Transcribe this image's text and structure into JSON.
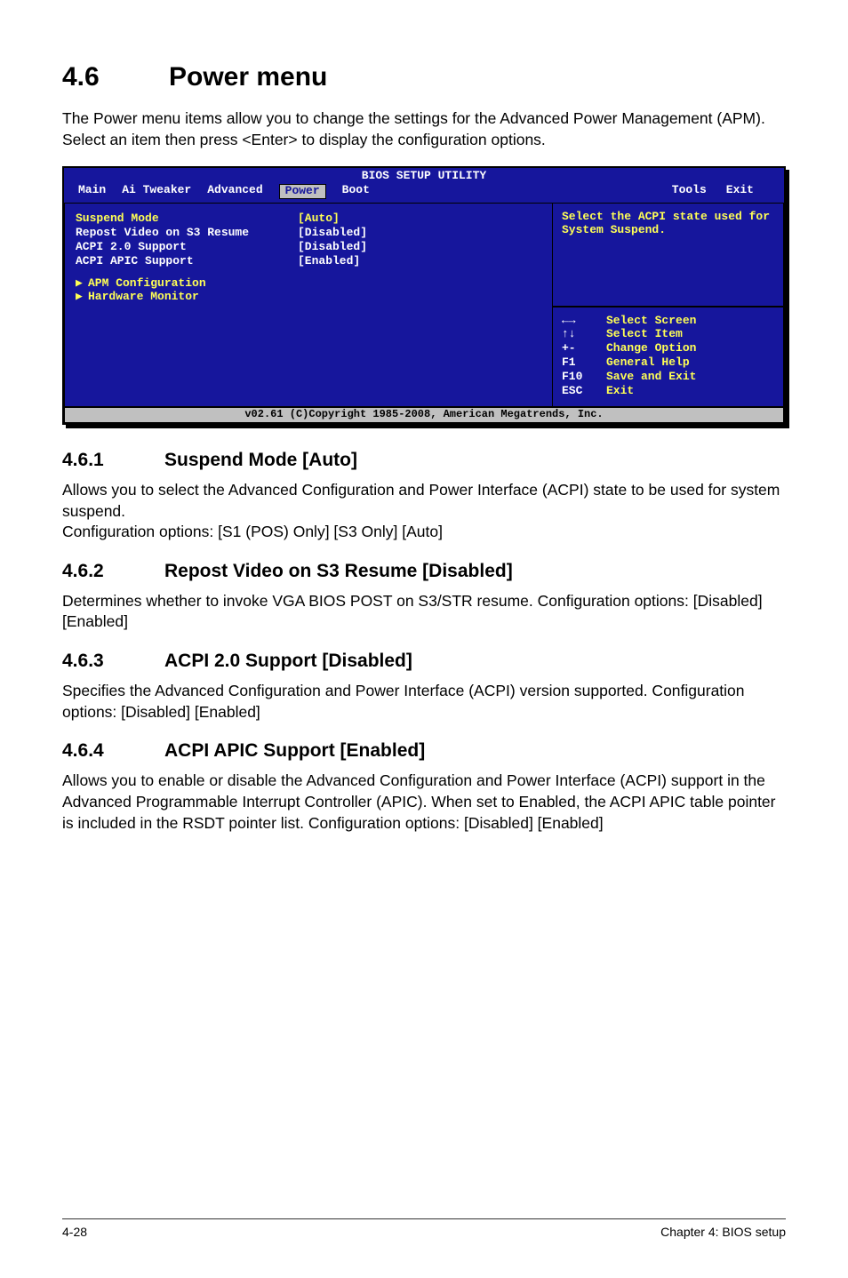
{
  "heading": {
    "num": "4.6",
    "title": "Power menu"
  },
  "intro": "The Power menu items allow you to change the settings for the Advanced Power Management (APM). Select an item then press <Enter> to display the configuration options.",
  "bios": {
    "title": "BIOS SETUP UTILITY",
    "menus": [
      "Main",
      "Ai Tweaker",
      "Advanced",
      "Power",
      "Boot",
      "Tools",
      "Exit"
    ],
    "selected_menu": "Power",
    "options": [
      {
        "label": "Suspend Mode",
        "value": "[Auto]",
        "enabled": true
      },
      {
        "label": "Repost Video on S3 Resume",
        "value": "[Disabled]",
        "enabled": false
      },
      {
        "label": "ACPI 2.0 Support",
        "value": "[Disabled]",
        "enabled": false
      },
      {
        "label": "ACPI APIC Support",
        "value": "[Enabled]",
        "enabled": false
      }
    ],
    "submenus": [
      "APM Configuration",
      "Hardware Monitor"
    ],
    "help": "Select the ACPI state used for System Suspend.",
    "keys": [
      {
        "k": "←→",
        "d": "Select Screen"
      },
      {
        "k": "↑↓",
        "d": "Select Item"
      },
      {
        "k": "+-",
        "d": "Change Option"
      },
      {
        "k": "F1",
        "d": "General Help"
      },
      {
        "k": "F10",
        "d": "Save and Exit"
      },
      {
        "k": "ESC",
        "d": "Exit"
      }
    ],
    "footer": "v02.61 (C)Copyright 1985-2008, American Megatrends, Inc."
  },
  "sections": [
    {
      "num": "4.6.1",
      "title": "Suspend Mode [Auto]",
      "body": "Allows you to select the Advanced Configuration and Power Interface (ACPI) state to be used for system suspend.\nConfiguration options: [S1 (POS) Only] [S3 Only] [Auto]"
    },
    {
      "num": "4.6.2",
      "title": "Repost Video on S3 Resume [Disabled]",
      "body": "Determines whether to invoke VGA BIOS POST on S3/STR resume. Configuration options: [Disabled] [Enabled]"
    },
    {
      "num": "4.6.3",
      "title": "ACPI 2.0 Support [Disabled]",
      "body": "Specifies the Advanced Configuration and Power Interface (ACPI) version supported. Configuration options: [Disabled] [Enabled]"
    },
    {
      "num": "4.6.4",
      "title": "ACPI APIC Support [Enabled]",
      "body": "Allows you to enable or disable the Advanced Configuration and Power Interface (ACPI) support in the Advanced Programmable Interrupt Controller (APIC). When set to Enabled, the ACPI APIC table pointer is included in the RSDT pointer list. Configuration options: [Disabled] [Enabled]"
    }
  ],
  "footer": {
    "left": "4-28",
    "right": "Chapter 4: BIOS setup"
  }
}
